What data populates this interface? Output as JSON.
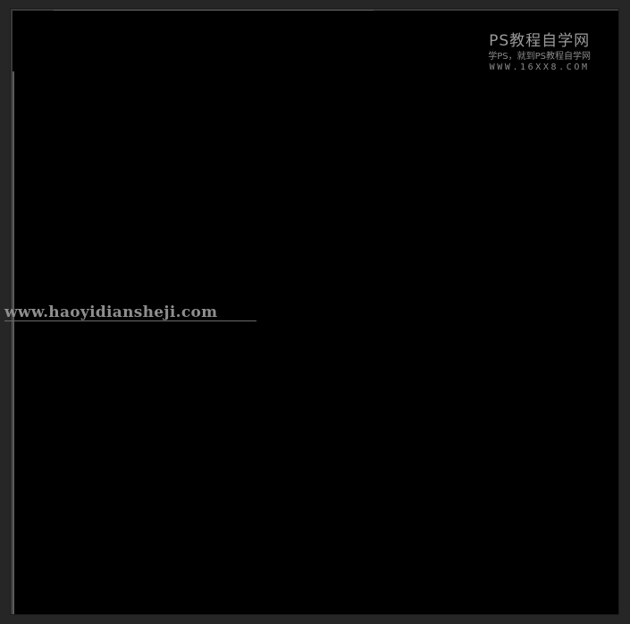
{
  "watermark_top": {
    "title": "PS教程自学网",
    "subtitle": "学PS，就到PS教程自学网",
    "url": "WWW.16XX8.COM"
  },
  "watermark_left": {
    "url": "www.haoyidiansheji.com"
  },
  "colors": {
    "workspace": "#262626",
    "canvas": "#000000",
    "watermark_text": "#8e8e8e"
  }
}
